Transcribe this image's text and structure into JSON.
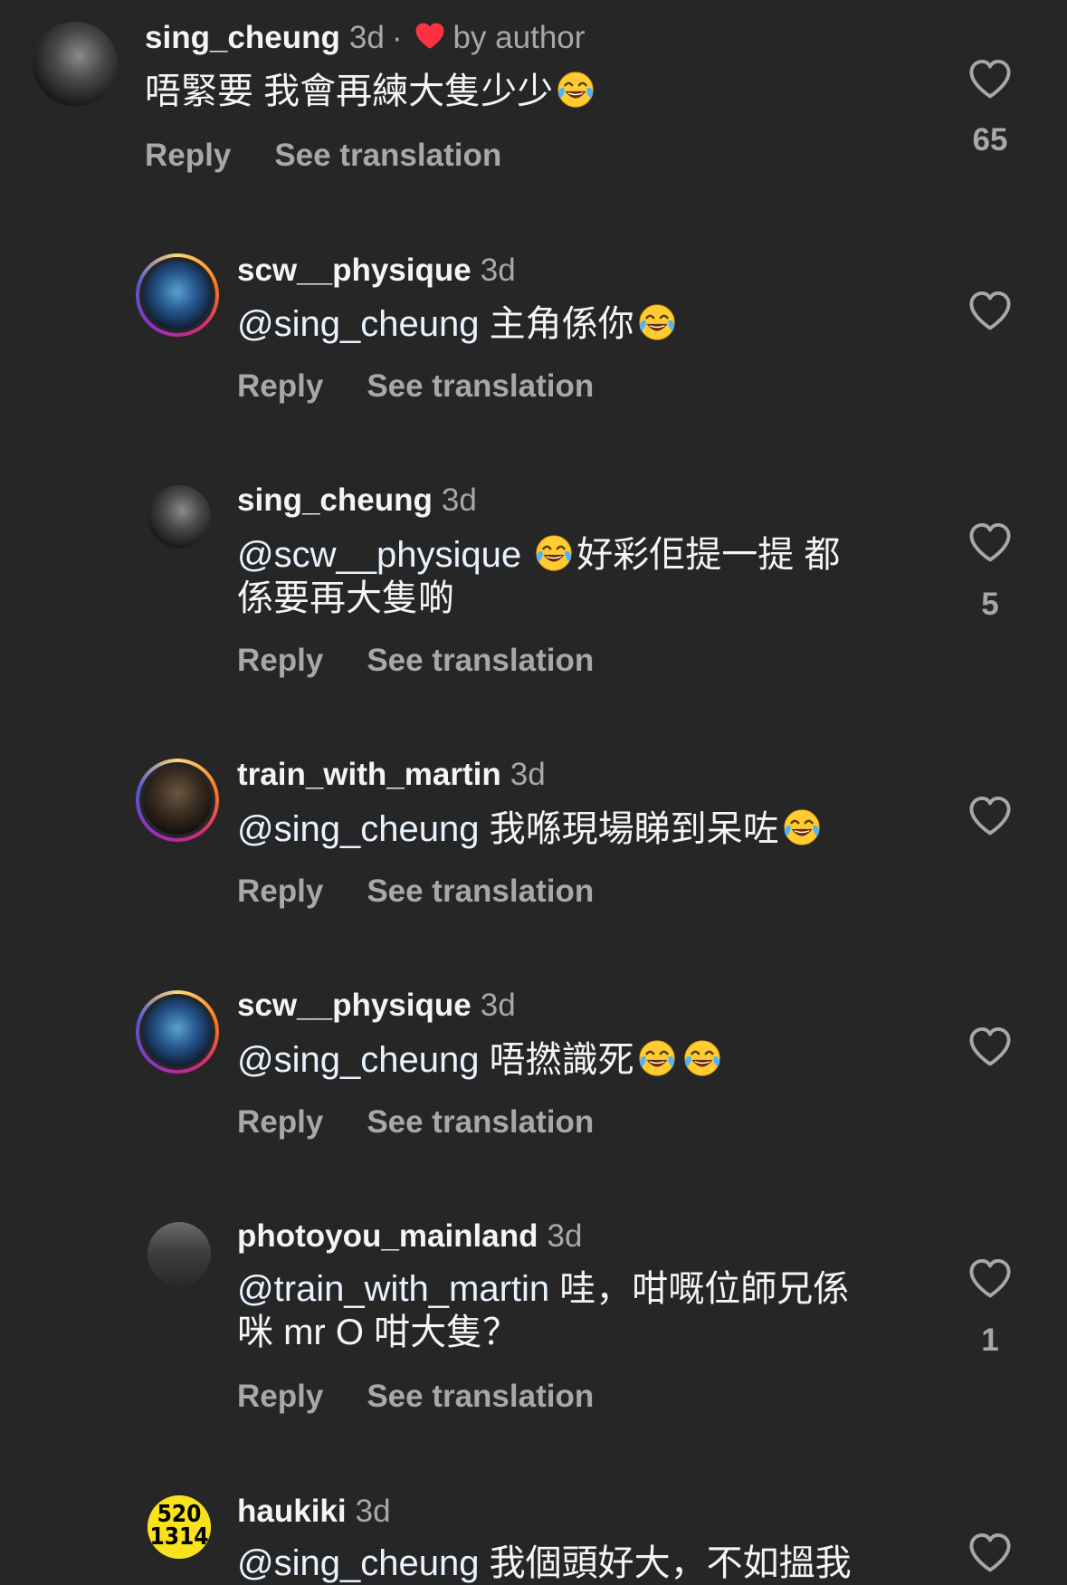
{
  "comments": [
    {
      "user": "sing_cheung",
      "time": "3d",
      "badge": "by author",
      "text": "唔緊要 我會再練大隻少少",
      "reply": "Reply",
      "translate": "See translation",
      "likes": "65"
    },
    {
      "user": "scw__physique",
      "time": "3d",
      "mention": "@sing_cheung",
      "text": "主角係你",
      "reply": "Reply",
      "translate": "See translation"
    },
    {
      "user": "sing_cheung",
      "time": "3d",
      "mention": "@scw__physique",
      "text1": "好彩佢提一提 都",
      "text2": "係要再大隻啲",
      "reply": "Reply",
      "translate": "See translation",
      "likes": "5"
    },
    {
      "user": "train_with_martin",
      "time": "3d",
      "mention": "@sing_cheung",
      "text": "我喺現場睇到呆咗",
      "reply": "Reply",
      "translate": "See translation"
    },
    {
      "user": "scw__physique",
      "time": "3d",
      "mention": "@sing_cheung",
      "text": "唔撚識死",
      "reply": "Reply",
      "translate": "See translation"
    },
    {
      "user": "photoyou_mainland",
      "time": "3d",
      "mention": "@train_with_martin",
      "text1": " 哇，咁嘅位師兄係",
      "text2": "咪 mr O 咁大隻？",
      "reply": "Reply",
      "translate": "See translation",
      "likes": "1"
    },
    {
      "user": "haukiki",
      "time": "3d",
      "mention": "@sing_cheung",
      "text": "我個頭好大，不如搵我",
      "avatar_text1": "520",
      "avatar_text2": "1314"
    }
  ],
  "colors": {
    "background": "#262626",
    "primary_text": "#f5f5f5",
    "secondary_text": "#a8a8a8",
    "author_heart": "#ff3040"
  },
  "icons": {
    "like": "heart-outline-icon",
    "author_like": "heart-filled-icon",
    "emoji": "face-with-tears-of-joy"
  }
}
